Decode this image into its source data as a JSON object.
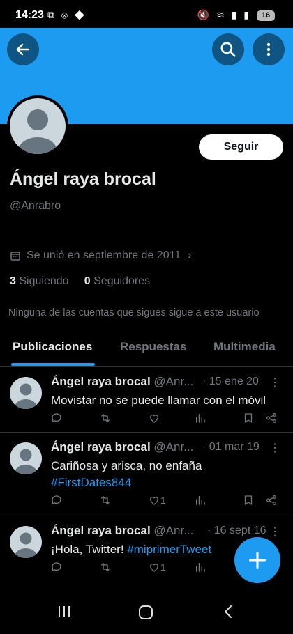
{
  "status_bar": {
    "time": "14:23",
    "battery": "16"
  },
  "profile": {
    "follow_label": "Seguir",
    "name": "Ángel raya brocal",
    "handle": "@Anrabro",
    "joined": "Se unió en septiembre de 2011",
    "following_count": "3",
    "following_label": "Siguiendo",
    "followers_count": "0",
    "followers_label": "Seguidores",
    "no_follow_note": "Ninguna de las cuentas que sigues sigue a este usuario"
  },
  "tabs": [
    {
      "label": "Publicaciones",
      "active": true
    },
    {
      "label": "Respuestas",
      "active": false
    },
    {
      "label": "Multimedia",
      "active": false
    }
  ],
  "tweets": [
    {
      "name": "Ángel raya brocal",
      "handle": "@Anr...",
      "date": "· 15 ene 20",
      "text": "Movistar no se puede llamar con el móvil",
      "hashtag": "",
      "likes": ""
    },
    {
      "name": "Ángel raya brocal",
      "handle": "@Anr...",
      "date": "· 01 mar 19",
      "text": "Cariñosa y arisca, no enfaña",
      "hashtag": "#FirstDates844",
      "likes": "1"
    },
    {
      "name": "Ángel raya brocal",
      "handle": "@Anr...",
      "date": "· 16 sept 16",
      "text": "¡Hola, Twitter!",
      "hashtag": "#miprimerTweet",
      "likes": "1"
    }
  ],
  "colors": {
    "accent": "#1d9bf0",
    "background": "#000000",
    "muted": "#71767b"
  },
  "icons": [
    "back-arrow-icon",
    "search-icon",
    "more-vertical-icon",
    "calendar-icon",
    "chevron-right-icon",
    "reply-icon",
    "retweet-icon",
    "like-icon",
    "views-icon",
    "bookmark-icon",
    "share-icon",
    "plus-icon"
  ]
}
